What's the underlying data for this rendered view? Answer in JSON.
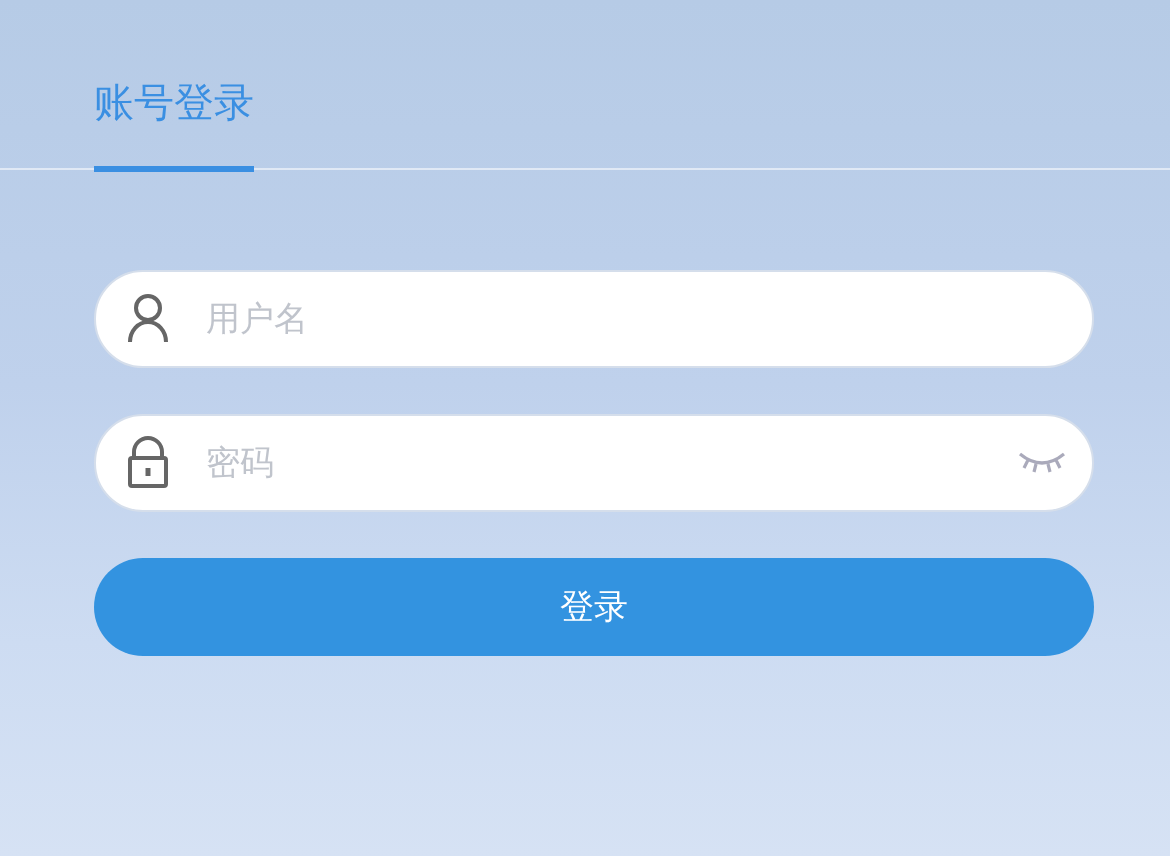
{
  "tabs": [
    {
      "label": "账号登录",
      "selected": true
    }
  ],
  "fields": [
    {
      "kind": "user",
      "placeholder": "用户名"
    },
    {
      "kind": "password",
      "placeholder": "密码",
      "password_visible": false
    }
  ],
  "submit_button": {
    "label": "登录"
  }
}
